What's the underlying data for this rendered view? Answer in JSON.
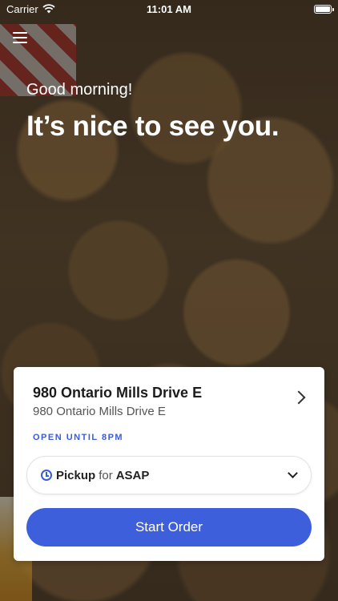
{
  "status_bar": {
    "carrier": "Carrier",
    "time": "11:01 AM"
  },
  "header": {
    "greeting": "Good morning!",
    "headline": "It’s nice to see you."
  },
  "location": {
    "name": "980 Ontario Mills Drive E",
    "address": "980 Ontario Mills Drive E",
    "hours": "OPEN UNTIL 8PM"
  },
  "pickup": {
    "mode": "Pickup",
    "connector": "for",
    "time": "ASAP"
  },
  "actions": {
    "start_order": "Start Order"
  },
  "colors": {
    "accent": "#3e5fdc",
    "hours_text": "#3b5bdb"
  },
  "icons": {
    "menu": "hamburger-icon",
    "wifi": "wifi-icon",
    "battery": "battery-icon",
    "chevron_right": "chevron-right-icon",
    "clock": "clock-icon",
    "chevron_down": "chevron-down-icon"
  }
}
